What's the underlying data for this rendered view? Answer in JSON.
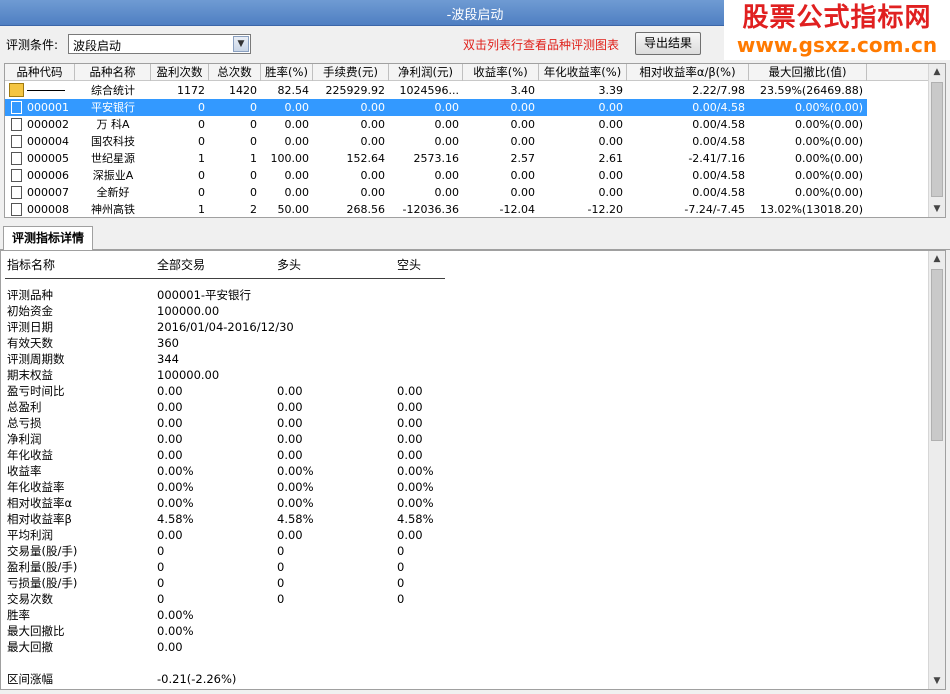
{
  "window": {
    "title": "-波段启动"
  },
  "watermark": {
    "line1": "股票公式指标网",
    "line2": "www.gsxz.com.cn"
  },
  "toolbar": {
    "condition_label": "评测条件:",
    "condition_value": "波段启动",
    "hint": "双击列表行查看品种评测图表",
    "export_label": "导出结果"
  },
  "grid": {
    "headers": [
      "品种代码",
      "品种名称",
      "盈利次数",
      "总次数",
      "胜率(%)",
      "手续费(元)",
      "净利润(元)",
      "收益率(%)",
      "年化收益率(%)",
      "相对收益率α/β(%)",
      "最大回撤比(值)"
    ],
    "rows": [
      {
        "code": "",
        "name": "综合统计",
        "win": "1172",
        "total": "1420",
        "rate": "82.54",
        "fee": "225929.92",
        "net": "1024596...",
        "ret": "3.40",
        "annual": "3.39",
        "ab": "2.22/7.98",
        "dd": "23.59%(26469.88)"
      },
      {
        "code": "000001",
        "name": "平安银行",
        "win": "0",
        "total": "0",
        "rate": "0.00",
        "fee": "0.00",
        "net": "0.00",
        "ret": "0.00",
        "annual": "0.00",
        "ab": "0.00/4.58",
        "dd": "0.00%(0.00)"
      },
      {
        "code": "000002",
        "name": "万 科A",
        "win": "0",
        "total": "0",
        "rate": "0.00",
        "fee": "0.00",
        "net": "0.00",
        "ret": "0.00",
        "annual": "0.00",
        "ab": "0.00/4.58",
        "dd": "0.00%(0.00)"
      },
      {
        "code": "000004",
        "name": "国农科技",
        "win": "0",
        "total": "0",
        "rate": "0.00",
        "fee": "0.00",
        "net": "0.00",
        "ret": "0.00",
        "annual": "0.00",
        "ab": "0.00/4.58",
        "dd": "0.00%(0.00)"
      },
      {
        "code": "000005",
        "name": "世纪星源",
        "win": "1",
        "total": "1",
        "rate": "100.00",
        "fee": "152.64",
        "net": "2573.16",
        "ret": "2.57",
        "annual": "2.61",
        "ab": "-2.41/7.16",
        "dd": "0.00%(0.00)"
      },
      {
        "code": "000006",
        "name": "深振业A",
        "win": "0",
        "total": "0",
        "rate": "0.00",
        "fee": "0.00",
        "net": "0.00",
        "ret": "0.00",
        "annual": "0.00",
        "ab": "0.00/4.58",
        "dd": "0.00%(0.00)"
      },
      {
        "code": "000007",
        "name": "全新好",
        "win": "0",
        "total": "0",
        "rate": "0.00",
        "fee": "0.00",
        "net": "0.00",
        "ret": "0.00",
        "annual": "0.00",
        "ab": "0.00/4.58",
        "dd": "0.00%(0.00)"
      },
      {
        "code": "000008",
        "name": "神州高铁",
        "win": "1",
        "total": "2",
        "rate": "50.00",
        "fee": "268.56",
        "net": "-12036.36",
        "ret": "-12.04",
        "annual": "-12.20",
        "ab": "-7.24/-7.45",
        "dd": "13.02%(13018.20)"
      }
    ]
  },
  "tab": {
    "label": "评测指标详情"
  },
  "detail": {
    "headers": [
      "指标名称",
      "全部交易",
      "多头",
      "空头"
    ],
    "rows": [
      {
        "name": "",
        "all": "",
        "long": "",
        "short": ""
      },
      {
        "name": "评测品种",
        "all": "000001-平安银行",
        "long": "",
        "short": ""
      },
      {
        "name": "初始资金",
        "all": "100000.00",
        "long": "",
        "short": ""
      },
      {
        "name": "评测日期",
        "all": "2016/01/04-2016/12/30",
        "long": "",
        "short": ""
      },
      {
        "name": "有效天数",
        "all": "360",
        "long": "",
        "short": ""
      },
      {
        "name": "评测周期数",
        "all": "344",
        "long": "",
        "short": ""
      },
      {
        "name": "期末权益",
        "all": "100000.00",
        "long": "",
        "short": ""
      },
      {
        "name": "盈亏时间比",
        "all": "0.00",
        "long": "0.00",
        "short": "0.00"
      },
      {
        "name": "总盈利",
        "all": "0.00",
        "long": "0.00",
        "short": "0.00"
      },
      {
        "name": "总亏损",
        "all": "0.00",
        "long": "0.00",
        "short": "0.00"
      },
      {
        "name": "净利润",
        "all": "0.00",
        "long": "0.00",
        "short": "0.00"
      },
      {
        "name": "年化收益",
        "all": "0.00",
        "long": "0.00",
        "short": "0.00"
      },
      {
        "name": "收益率",
        "all": "0.00%",
        "long": "0.00%",
        "short": "0.00%"
      },
      {
        "name": "年化收益率",
        "all": "0.00%",
        "long": "0.00%",
        "short": "0.00%"
      },
      {
        "name": "相对收益率α",
        "all": "0.00%",
        "long": "0.00%",
        "short": "0.00%"
      },
      {
        "name": "相对收益率β",
        "all": "4.58%",
        "long": "4.58%",
        "short": "4.58%"
      },
      {
        "name": "平均利润",
        "all": "0.00",
        "long": "0.00",
        "short": "0.00"
      },
      {
        "name": "交易量(股/手)",
        "all": "0",
        "long": "0",
        "short": "0"
      },
      {
        "name": "盈利量(股/手)",
        "all": "0",
        "long": "0",
        "short": "0"
      },
      {
        "name": "亏损量(股/手)",
        "all": "0",
        "long": "0",
        "short": "0"
      },
      {
        "name": "交易次数",
        "all": "0",
        "long": "0",
        "short": "0"
      },
      {
        "name": "胜率",
        "all": "0.00%",
        "long": "",
        "short": ""
      },
      {
        "name": "最大回撤比",
        "all": "0.00%",
        "long": "",
        "short": ""
      },
      {
        "name": "最大回撤",
        "all": "0.00",
        "long": "",
        "short": ""
      },
      {
        "name": "",
        "all": "",
        "long": "",
        "short": ""
      },
      {
        "name": "区间涨幅",
        "all": "-0.21(-2.26%)",
        "long": "",
        "short": ""
      }
    ]
  },
  "colors": {
    "selection": "#3399ff",
    "hint": "#e0201a",
    "watermark_red": "#e02020",
    "watermark_orange": "#ff7a00"
  }
}
